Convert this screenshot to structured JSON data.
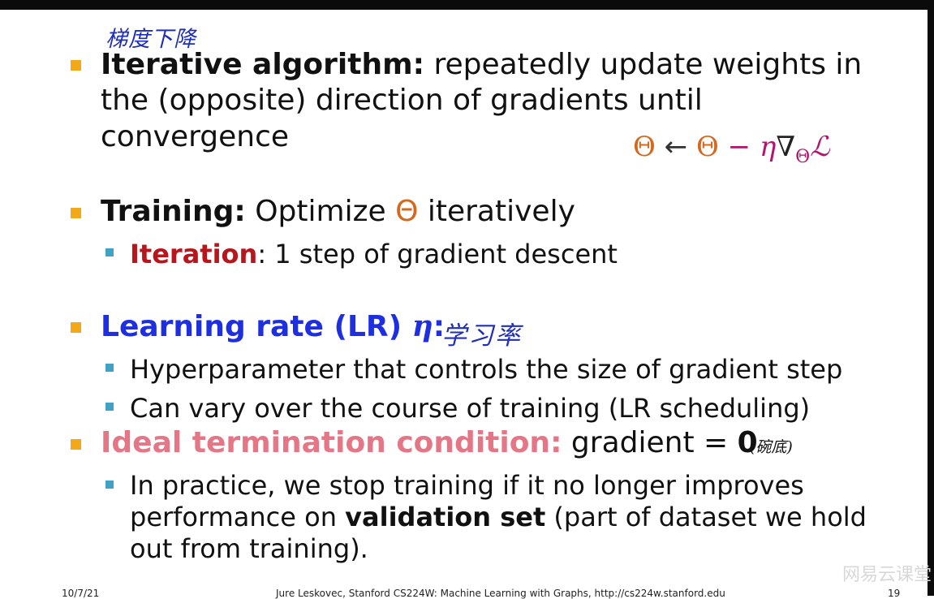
{
  "annotations": {
    "gradient_descent": "梯度下降",
    "learning_rate": "学习率",
    "bowl_bottom": "(碗底)"
  },
  "bullet1": {
    "term": "Iterative algorithm:",
    "line1_rest": " repeatedly update weights in",
    "line2": "the (opposite) direction of gradients until",
    "line3": "convergence"
  },
  "formula": {
    "theta_left": "Θ",
    "arrow": " ← ",
    "theta_right": "Θ",
    "minus": " − ",
    "eta": "η",
    "nabla": "∇",
    "subscript": "Θ",
    "loss": "ℒ"
  },
  "bullet2": {
    "term": "Training:",
    "text_before": " Optimize ",
    "theta": "Θ",
    "text_after": " iteratively",
    "sub": {
      "term": "Iteration",
      "text": ": 1 step of gradient descent"
    }
  },
  "bullet3": {
    "term": "Learning rate (LR) ",
    "eta": "η",
    "colon": ":",
    "subs": [
      "Hyperparameter that controls the size of gradient step",
      "Can vary over the course of training (LR scheduling)"
    ]
  },
  "bullet4": {
    "term": "Ideal termination condition:",
    "text": " gradient = ",
    "zero": "0",
    "sub": {
      "line1": "In practice, we stop training if it no longer improves",
      "line2_before": "performance on ",
      "line2_bold": "validation set",
      "line2_after": " (part of dataset we hold",
      "line3": "out from training)."
    }
  },
  "footer": {
    "date": "10/7/21",
    "credit": "Jure Leskovec, Stanford CS224W: Machine Learning with Graphs, http://cs224w.stanford.edu",
    "page": "19"
  },
  "watermark": "网易云课堂",
  "colors": {
    "bullet": "#f3a917",
    "sub_bullet": "#3fa3c5",
    "iteration_red": "#b8151c",
    "learning_rate_blue": "#1d2fe0",
    "termination_pink": "#e47685",
    "theta_orange": "#d2691e",
    "formula_magenta": "#b0166e",
    "handwriting_blue": "#1f2fb8"
  }
}
